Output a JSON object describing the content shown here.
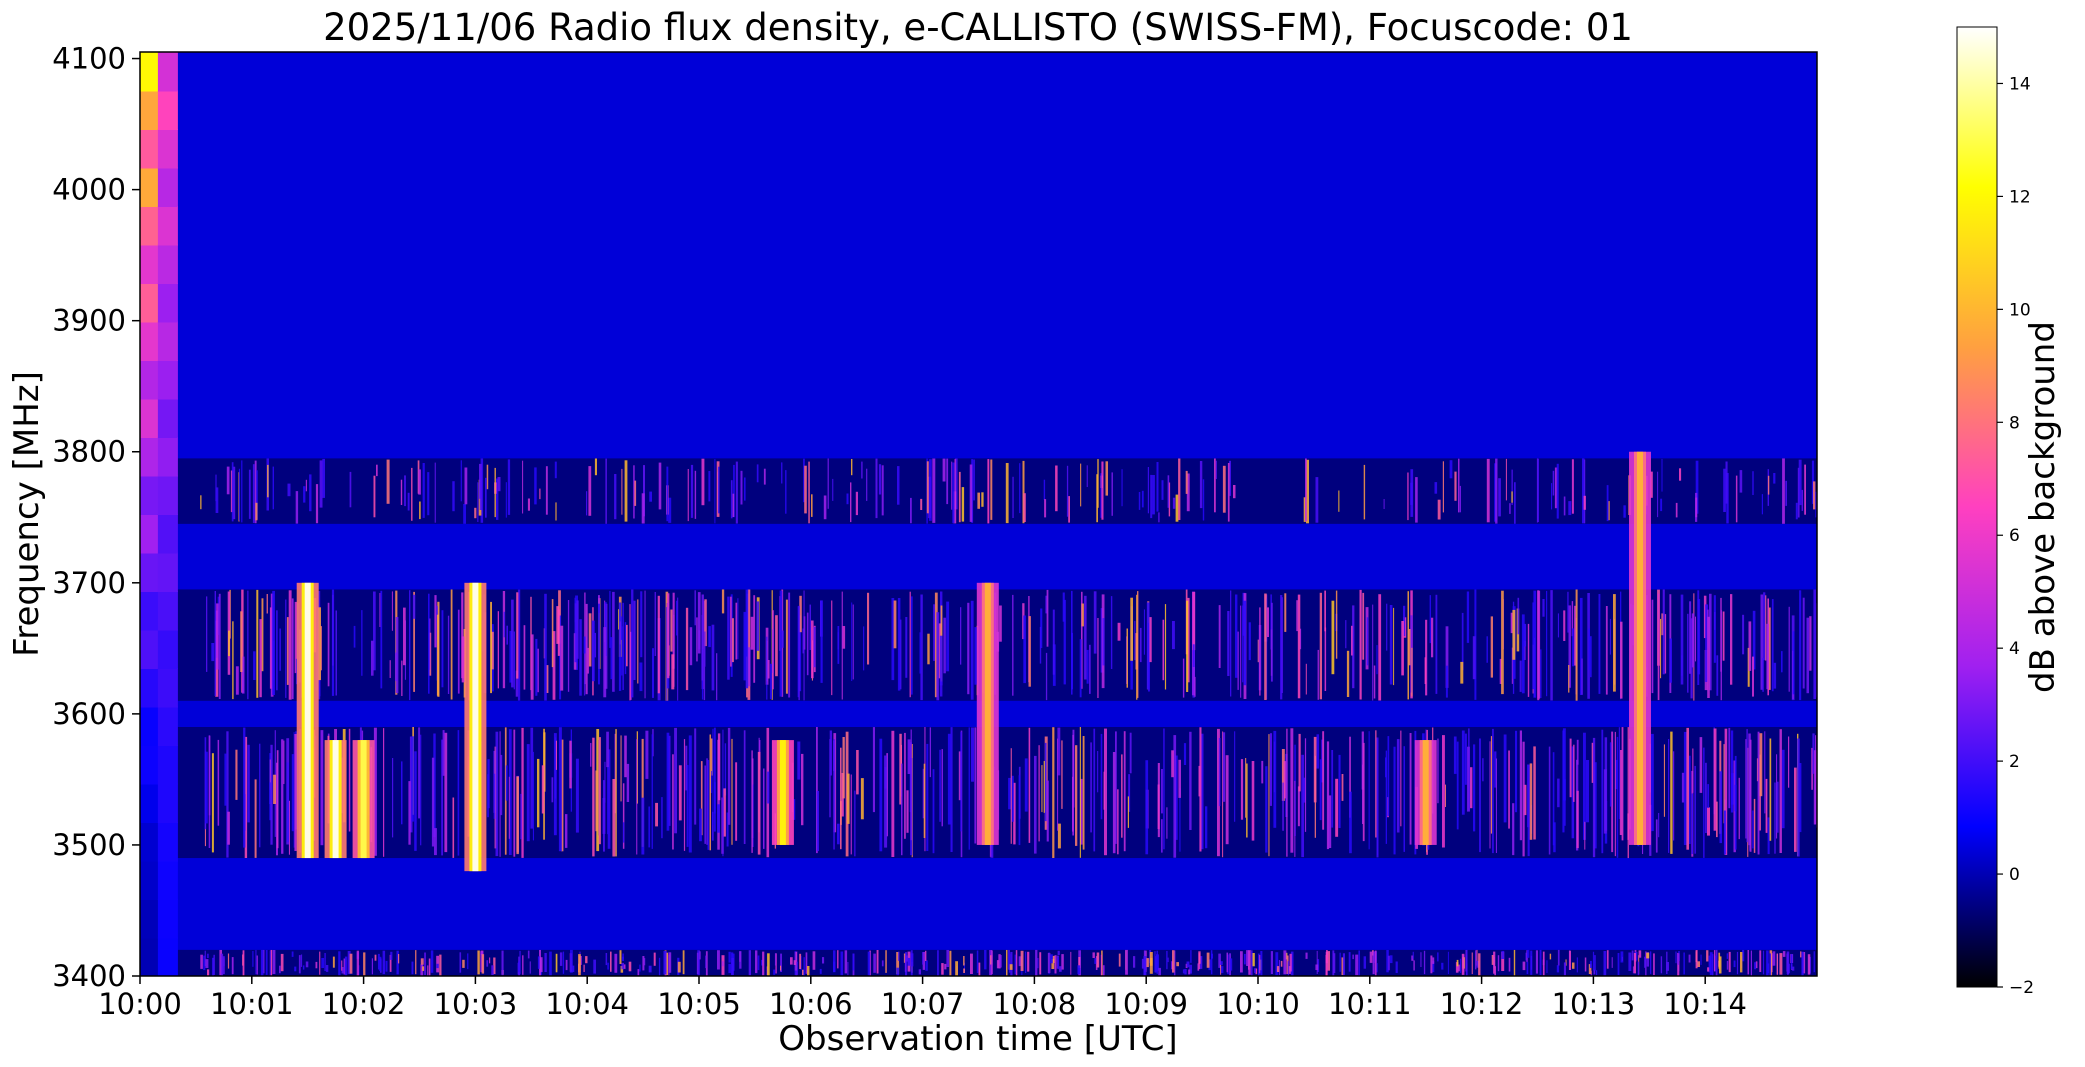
{
  "chart_data": {
    "type": "heatmap",
    "title": "2025/11/06  Radio flux density, e-CALLISTO (SWISS-FM), Focuscode: 01",
    "xlabel": "Observation time [UTC]",
    "ylabel": "Frequency [MHz]",
    "x_range": [
      "10:00",
      "10:15"
    ],
    "y_range": [
      3400,
      4105
    ],
    "x_ticks": [
      "10:00",
      "10:01",
      "10:02",
      "10:03",
      "10:04",
      "10:05",
      "10:06",
      "10:07",
      "10:08",
      "10:09",
      "10:10",
      "10:11",
      "10:12",
      "10:13",
      "10:14"
    ],
    "y_ticks": [
      3400,
      3500,
      3600,
      3700,
      3800,
      3900,
      4000,
      4100
    ],
    "colorbar": {
      "label": "dB above background",
      "range": [
        -2,
        15
      ],
      "ticks": [
        -2,
        0,
        2,
        4,
        6,
        8,
        10,
        12,
        14
      ],
      "colormap": "gnuplot2",
      "stops": [
        "#000000",
        "#0000ff",
        "#a020f0",
        "#ff40c0",
        "#ffa040",
        "#ffff00",
        "#ffffff"
      ]
    },
    "bands": [
      {
        "from": 3400,
        "to": 3420,
        "activity": "high"
      },
      {
        "from": 3420,
        "to": 3490,
        "activity": "low"
      },
      {
        "from": 3490,
        "to": 3590,
        "activity": "high"
      },
      {
        "from": 3590,
        "to": 3610,
        "activity": "low"
      },
      {
        "from": 3610,
        "to": 3695,
        "activity": "high"
      },
      {
        "from": 3695,
        "to": 3745,
        "activity": "low"
      },
      {
        "from": 3745,
        "to": 3795,
        "activity": "medium"
      },
      {
        "from": 3795,
        "to": 4105,
        "activity": "low"
      }
    ],
    "bursts": [
      {
        "time": "10:01:30",
        "from": 3490,
        "to": 3700,
        "peak_db": 15
      },
      {
        "time": "10:01:45",
        "from": 3490,
        "to": 3580,
        "peak_db": 15
      },
      {
        "time": "10:02:00",
        "from": 3490,
        "to": 3580,
        "peak_db": 13
      },
      {
        "time": "10:03:00",
        "from": 3480,
        "to": 3700,
        "peak_db": 15
      },
      {
        "time": "10:05:45",
        "from": 3500,
        "to": 3580,
        "peak_db": 12
      },
      {
        "time": "10:07:35",
        "from": 3500,
        "to": 3700,
        "peak_db": 10
      },
      {
        "time": "10:11:30",
        "from": 3500,
        "to": 3580,
        "peak_db": 10
      },
      {
        "time": "10:13:25",
        "from": 3500,
        "to": 3800,
        "peak_db": 10
      }
    ],
    "calibration_columns": [
      {
        "time": "10:00:05",
        "min_db": 0,
        "max_db": 12
      },
      {
        "time": "10:00:15",
        "min_db": 1,
        "max_db": 7
      }
    ]
  }
}
